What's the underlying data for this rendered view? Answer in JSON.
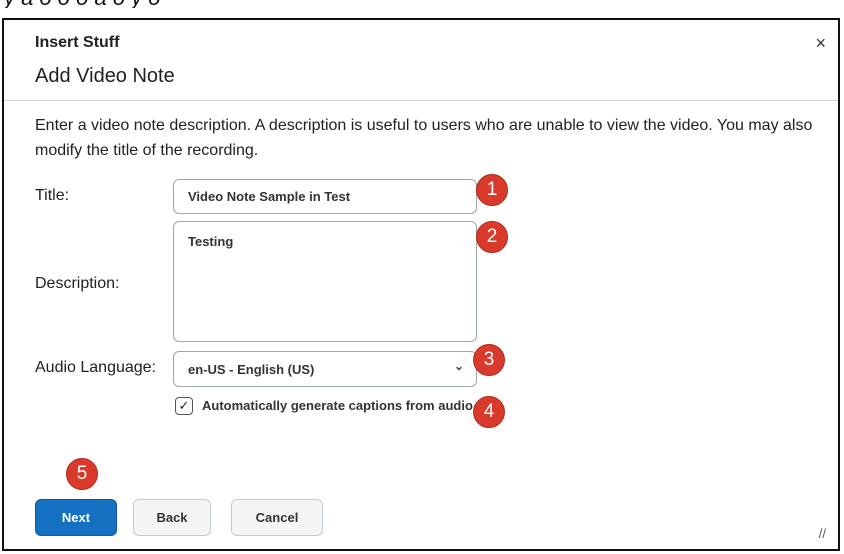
{
  "top_fragment": "y a o o o a o y o",
  "dialog": {
    "header_label": "Insert Stuff",
    "close_glyph": "×",
    "title": "Add Video Note",
    "description": "Enter a video note description. A description is useful to users who are unable to view the video. You may also modify the title of the recording.",
    "fields": {
      "title_label": "Title:",
      "title_value": "Video Note Sample in Test",
      "description_label": "Description:",
      "description_value": "Testing",
      "language_label": "Audio Language:",
      "language_value": "en-US - English (US)",
      "captions_label": "Automatically generate captions from audio",
      "captions_checked": true
    },
    "buttons": {
      "next": "Next",
      "back": "Back",
      "cancel": "Cancel"
    }
  },
  "badges": [
    "1",
    "2",
    "3",
    "4",
    "5"
  ],
  "colors": {
    "primary": "#1470c1",
    "badge": "#d93a2b"
  }
}
